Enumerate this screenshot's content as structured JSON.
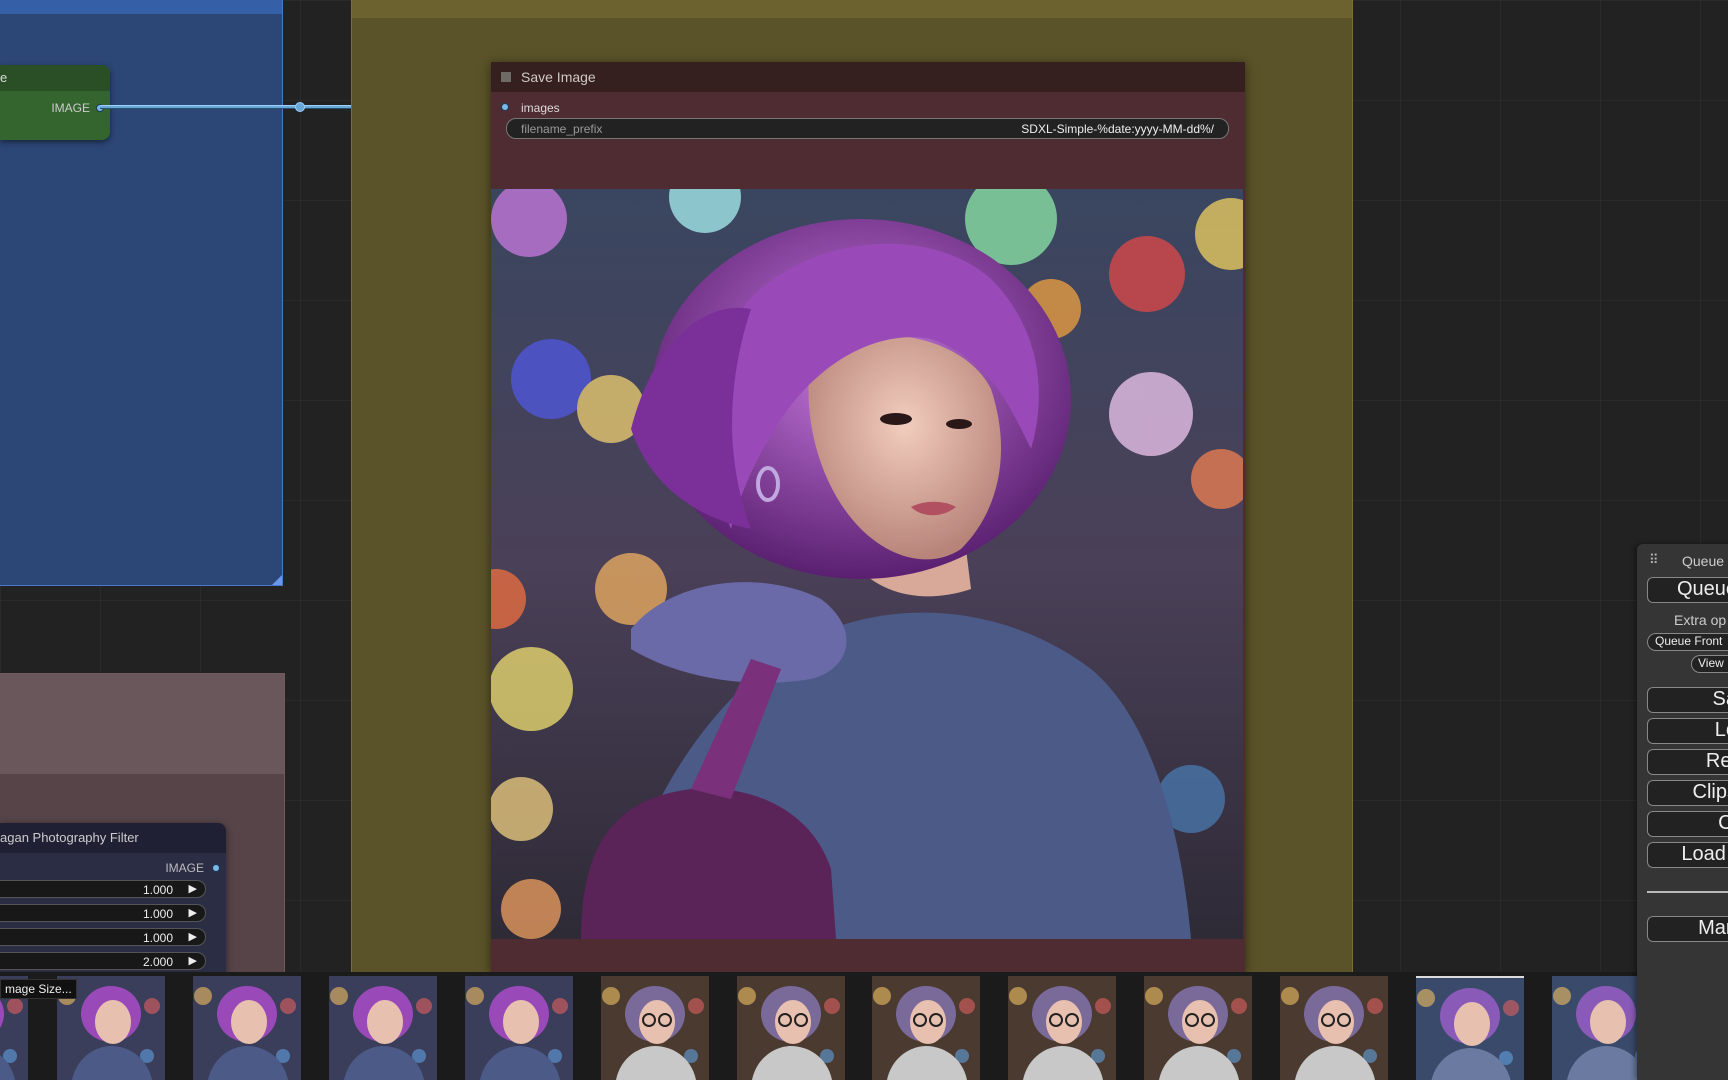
{
  "green_node": {
    "title": "e",
    "output_label": "IMAGE"
  },
  "save_node": {
    "title": "Save Image",
    "input_label": "images",
    "widget_label": "filename_prefix",
    "widget_value": "SDXL-Simple-%date:yyyy-MM-dd%/"
  },
  "filter_node": {
    "title": "agan Photography Filter",
    "output_label": "IMAGE",
    "values": [
      "1.000",
      "1.000",
      "1.000",
      "2.000"
    ]
  },
  "tooltip": "mage Size...",
  "queue_panel": {
    "title": "Queue",
    "queue_button": "Queue",
    "extra_options": "Extra op",
    "queue_front": "Queue Front",
    "view": "View",
    "buttons": [
      "Sa",
      "Lo",
      "Ref",
      "Clips",
      "Cl",
      "Load I"
    ],
    "manager": "Man"
  },
  "thumbnails": [
    "thumb-1",
    "thumb-2",
    "thumb-3",
    "thumb-4",
    "thumb-5",
    "thumb-6",
    "thumb-7",
    "thumb-8",
    "thumb-9",
    "thumb-10",
    "thumb-11",
    "thumb-12",
    "thumb-13",
    "thumb-14"
  ],
  "colors": {
    "link": "#6aa8d8",
    "blue_group": "#2c4676",
    "yellow_group": "#5a5228",
    "save_node": "#4f2c31"
  }
}
